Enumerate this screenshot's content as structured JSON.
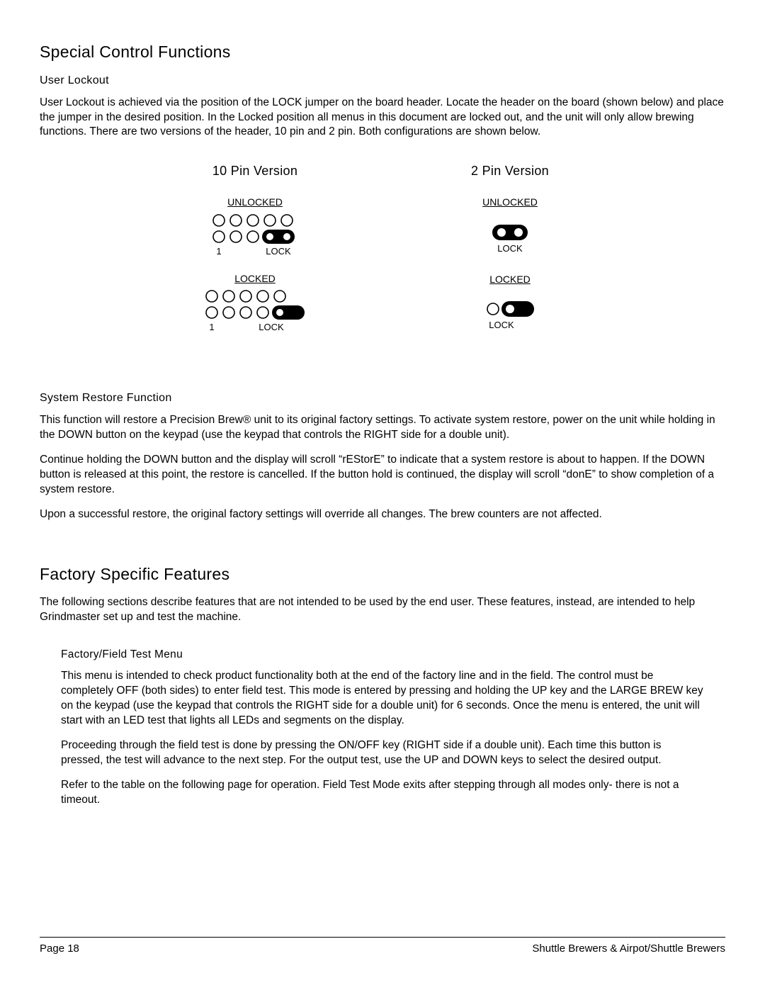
{
  "h1_special": "Special Control Functions",
  "h2_userlockout": "User Lockout",
  "p_userlockout": "User Lockout is achieved via the position of the LOCK jumper on the board header. Locate the header on the board (shown below) and place the jumper in the desired position. In the Locked position all menus in this document are locked out, and the unit will only allow brewing functions. There are two versions of the header, 10 pin and 2 pin. Both configurations are shown below.",
  "diag": {
    "ten_title": "10 Pin Version",
    "two_title": "2 Pin Version",
    "unlocked": "UNLOCKED",
    "locked": "LOCKED",
    "lock": "LOCK",
    "pin1": "1"
  },
  "h2_sysrestore": "System Restore Function",
  "p_sysrestore1": "This function will restore a Precision Brew® unit to its original factory settings. To activate system restore, power on the unit while holding in the DOWN button on the keypad (use the keypad that controls the RIGHT side for a double unit).",
  "p_sysrestore2": "Continue holding the DOWN button and the display will scroll “rEStorE” to indicate that a system restore is about to happen. If the DOWN button is released at this point, the restore is cancelled. If the button hold is continued, the display will scroll “donE” to show completion of a system restore.",
  "p_sysrestore3": "Upon a successful restore, the original factory settings will override all changes. The brew counters are not affected.",
  "h1_factory": "Factory Specific Features",
  "p_factory_intro": "The following sections describe features that are not intended to be used by the end user. These features, instead, are intended to help Grindmaster set up and test the machine.",
  "h3_fieldtest": "Factory/Field Test Menu",
  "p_fieldtest1": "This menu is intended to check product functionality both at the end of the factory line and in the field. The control must be completely OFF (both sides) to enter field test. This mode is entered by pressing and holding the UP key and the LARGE BREW key on the keypad (use the keypad that controls the RIGHT side for a double unit) for 6 seconds. Once the menu is entered, the unit will start with an LED test that lights all LEDs and segments on the display.",
  "p_fieldtest2": "Proceeding through the field test is done by pressing the ON/OFF key (RIGHT side if a double unit). Each time this button is pressed, the test will advance to the next step. For the output test, use the UP and DOWN keys to select the desired output.",
  "p_fieldtest3": "Refer to the table on the following page for operation. Field Test Mode exits after stepping through all modes only- there is not a timeout.",
  "footer_left": "Page 18",
  "footer_right": "Shuttle Brewers & Airpot/Shuttle Brewers"
}
